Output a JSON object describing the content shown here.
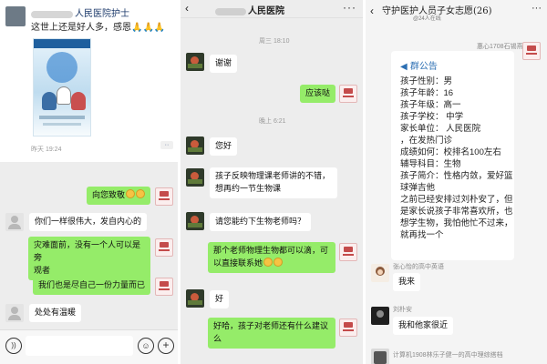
{
  "panel1": {
    "moment": {
      "name_suffix": "人民医院护士",
      "text": "这世上还是好人多，感恩🙏🙏🙏",
      "time": "昨天 19:24",
      "more_label": "··"
    },
    "messages": [
      {
        "text": "向您致敬",
        "side": "right"
      },
      {
        "text": "你们一样很伟大，发自内心的",
        "side": "left"
      },
      {
        "text": "灾难面前，没有一个人可以是旁",
        "text2": "观者",
        "side": "right"
      },
      {
        "text": "我们也是尽自己一份力量而已",
        "side": "right"
      },
      {
        "text": "处处有温暖",
        "side": "left"
      }
    ],
    "input": {
      "voice_label": "))",
      "emoji_label": "☺",
      "plus_label": "+"
    }
  },
  "panel2": {
    "title_suffix": "人民医院",
    "back_label": "‹",
    "more_label": "···",
    "time1": "周三 18:10",
    "time2": "晚上 6:21",
    "messages": [
      {
        "text": "谢谢",
        "side": "left"
      },
      {
        "text": "应该哒",
        "side": "right"
      },
      {
        "text": "您好",
        "side": "left"
      },
      {
        "text": "孩子反映物理课老师讲的不错，",
        "text2": "想再约一节生物课",
        "side": "left"
      },
      {
        "text": "请您能约下生物老师吗？",
        "side": "left"
      },
      {
        "text": "那个老师物理生物都可以滴，可",
        "text2": "以直接联系她",
        "side": "right"
      },
      {
        "text": "好",
        "side": "left"
      },
      {
        "text": "好哈，孩子对老师还有什么建议",
        "text2": "么",
        "side": "right"
      }
    ]
  },
  "panel3": {
    "back_label": "‹",
    "title": "守护医护人员子女志愿(26)",
    "subtitle": "@24人在线",
    "more_label": "···",
    "sender_top": "惠心1708石锡燕",
    "notice": {
      "head": "群公告",
      "lines": [
        "孩子性别：男",
        "孩子年龄：16",
        "孩子年级：高一",
        "孩子学校：          中学",
        "家长单位：          人民医院",
        "，在发热门诊",
        "成绩如何：校排名100左右",
        "辅导科目：生物",
        "孩子简介：性格内敛，爱好篮",
        "球弹吉他",
        "之前已经安排过刘朴安了，但",
        "是家长说孩子非常喜欢所，也",
        "想学生物，我怕他忙不过来，",
        "就再找一个"
      ]
    },
    "msgs": [
      {
        "sender": "张心怡的高中英语",
        "text": "我来"
      },
      {
        "sender": "刘朴安",
        "text": "我和他家很近"
      },
      {
        "sender": "计算机1908林乐子健一的高中理综搭档",
        "text": ""
      }
    ]
  }
}
